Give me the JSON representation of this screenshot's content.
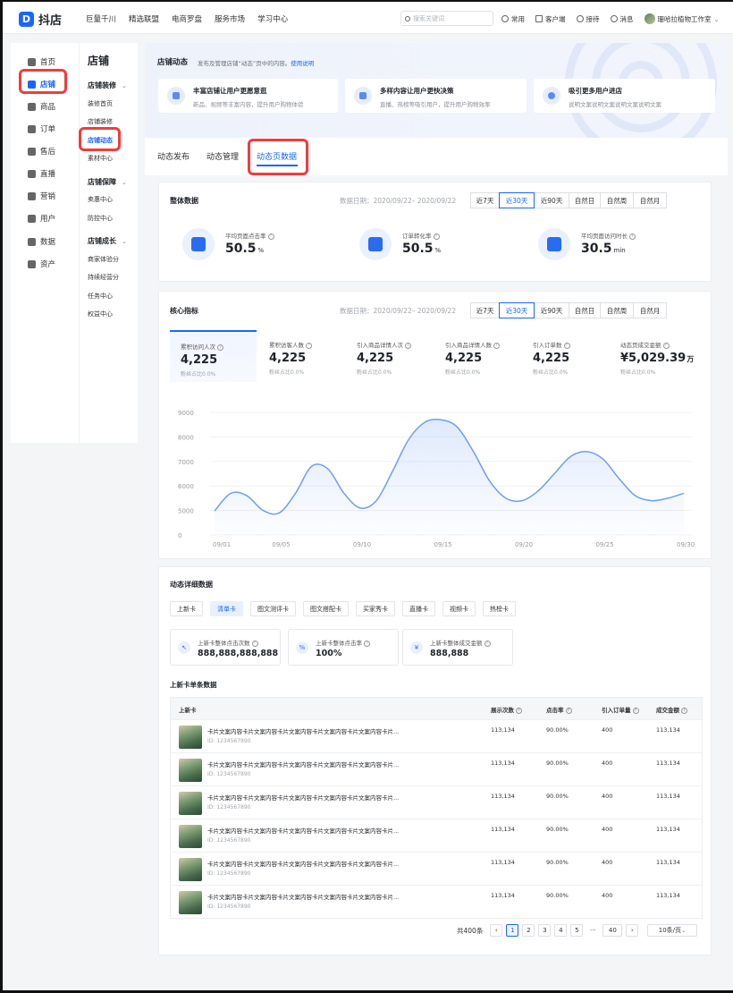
{
  "app": {
    "logo_text": "抖店"
  },
  "topnav": {
    "links": [
      "巨量千川",
      "精选联盟",
      "电商罗盘",
      "服务市场",
      "学习中心"
    ],
    "search_placeholder": "搜索关键词",
    "right": [
      "常用",
      "客户端",
      "接待",
      "消息"
    ],
    "shop_name": "珊哈拉植物工作室"
  },
  "sidebar": {
    "items": [
      {
        "label": "首页",
        "icon": "home-icon"
      },
      {
        "label": "店铺",
        "icon": "store-icon"
      },
      {
        "label": "商品",
        "icon": "product-icon"
      },
      {
        "label": "订单",
        "icon": "order-icon"
      },
      {
        "label": "售后",
        "icon": "aftersale-icon"
      },
      {
        "label": "直播",
        "icon": "live-icon"
      },
      {
        "label": "营销",
        "icon": "marketing-icon"
      },
      {
        "label": "用户",
        "icon": "user-icon"
      },
      {
        "label": "数据",
        "icon": "data-icon"
      },
      {
        "label": "资产",
        "icon": "asset-icon"
      }
    ],
    "active_index": 1
  },
  "subnav": {
    "title": "店铺",
    "groups": [
      {
        "label": "店铺装修",
        "items": [
          "装修首页",
          "店铺装修",
          "店铺动态",
          "素材中心"
        ]
      },
      {
        "label": "店铺保障",
        "items": [
          "卖惠中心",
          "防控中心"
        ]
      },
      {
        "label": "店铺成长",
        "items": [
          "商家体验分",
          "持续经营分",
          "任务中心",
          "权益中心"
        ]
      }
    ],
    "active_item": "店铺动态"
  },
  "banner": {
    "title": "店铺动态",
    "subtitle": "发布及管理店铺“动态”页中的内容。",
    "link": "使用说明",
    "features": [
      {
        "title": "丰富店铺让用户更愿意逛",
        "desc": "新品、视频等丰富内容，提升用户购物体验",
        "icon": "smile-icon"
      },
      {
        "title": "多样内容让用户更快决策",
        "desc": "直播、热榜等吸引用户，提升用户购物效率",
        "icon": "trend-icon"
      },
      {
        "title": "吸引更多用户进店",
        "desc": "说明文案说明文案说明文案说明文案",
        "icon": "person-icon"
      }
    ]
  },
  "tabs": {
    "items": [
      "动态发布",
      "动态管理",
      "动态页数据"
    ],
    "active": "动态页数据"
  },
  "overall": {
    "title": "整体数据",
    "date": "数据日期：2020/09/22– 2020/09/22",
    "ranges": [
      "近7天",
      "近30天",
      "近90天",
      "自然日",
      "自然周",
      "自然月"
    ],
    "active_range": "近30天",
    "kpis": [
      {
        "label": "平均页面点击率",
        "value": "50.5",
        "unit": "%"
      },
      {
        "label": "订单转化率",
        "value": "50.5",
        "unit": "%"
      },
      {
        "label": "平均页面访问时长",
        "value": "30.5",
        "unit": "min"
      }
    ]
  },
  "core": {
    "title": "核心指标",
    "date": "数据日期：2020/09/22– 2020/09/22",
    "ranges": [
      "近7天",
      "近30天",
      "近90天",
      "自然日",
      "自然周",
      "自然月"
    ],
    "active_range": "近30天",
    "metrics": [
      {
        "label": "累积访问人次",
        "value": "4,225",
        "sub": "粉丝占比0.0%"
      },
      {
        "label": "累积访客人数",
        "value": "4,225",
        "sub": "粉丝占比0.0%"
      },
      {
        "label": "引入商品详情人次",
        "value": "4,225",
        "sub": "粉丝占比0.0%"
      },
      {
        "label": "引入商品详情人数",
        "value": "4,225",
        "sub": "粉丝占比0.0%"
      },
      {
        "label": "引入订单数",
        "value": "4,225",
        "sub": "粉丝占比0.0%"
      },
      {
        "label": "动态页成交金额",
        "value": "¥5,029.39",
        "unit": "万",
        "sub": "粉丝占比0.0%"
      }
    ]
  },
  "chart_data": {
    "type": "area",
    "x_ticks": [
      "09/01",
      "09/05",
      "09/10",
      "09/15",
      "09/20",
      "09/25",
      "09/30"
    ],
    "y_ticks": [
      0,
      5000,
      6000,
      7000,
      8000,
      9000
    ],
    "points": [
      [
        1,
        4900
      ],
      [
        2,
        5700
      ],
      [
        3,
        5600
      ],
      [
        4,
        5000
      ],
      [
        5,
        4500
      ],
      [
        6,
        5700
      ],
      [
        7,
        6800
      ],
      [
        8,
        6700
      ],
      [
        9,
        5700
      ],
      [
        10,
        5100
      ],
      [
        11,
        5400
      ],
      [
        12,
        6600
      ],
      [
        13,
        7900
      ],
      [
        14,
        8600
      ],
      [
        15,
        8700
      ],
      [
        16,
        8400
      ],
      [
        17,
        7400
      ],
      [
        18,
        6200
      ],
      [
        19,
        5500
      ],
      [
        20,
        5400
      ],
      [
        21,
        5800
      ],
      [
        22,
        6500
      ],
      [
        23,
        7200
      ],
      [
        24,
        7400
      ],
      [
        25,
        7100
      ],
      [
        26,
        6300
      ],
      [
        27,
        5600
      ],
      [
        28,
        5400
      ],
      [
        29,
        5500
      ],
      [
        30,
        5700
      ]
    ]
  },
  "detail": {
    "title": "动态详细数据",
    "chips": [
      "上新卡",
      "清单卡",
      "图文测评卡",
      "图文搭配卡",
      "买家秀卡",
      "直播卡",
      "视频卡",
      "热榜卡"
    ],
    "active_chip": "清单卡",
    "summaries": [
      {
        "icon": "click-icon",
        "label": "上新卡整体点击次数",
        "value": "888,888,888,888"
      },
      {
        "icon": "percent-icon",
        "label": "上新卡整体点击率",
        "value": "100%"
      },
      {
        "icon": "yen-icon",
        "label": "上新卡整体成交金额",
        "value": "888,888"
      }
    ],
    "table_title": "上新卡单条数据",
    "columns": [
      "上新卡",
      "展示次数",
      "点击率",
      "引入订单量",
      "成交金额"
    ],
    "rows": [
      {
        "title": "卡片文案内容卡片文案内容卡片文案内容卡片文案内容卡片文案内容卡片...",
        "id": "ID: 1234567890",
        "views": "113,134",
        "ctr": "90.00%",
        "orders": "400",
        "amount": "113,134"
      },
      {
        "title": "卡片文案内容卡片文案内容卡片文案内容卡片文案内容卡片文案内容卡片...",
        "id": "ID: 1234567890",
        "views": "113,134",
        "ctr": "90.00%",
        "orders": "400",
        "amount": "113,134"
      },
      {
        "title": "卡片文案内容卡片文案内容卡片文案内容卡片文案内容卡片文案内容卡片...",
        "id": "ID: 1234567890",
        "views": "113,134",
        "ctr": "90.00%",
        "orders": "400",
        "amount": "113,134"
      },
      {
        "title": "卡片文案内容卡片文案内容卡片文案内容卡片文案内容卡片文案内容卡片...",
        "id": "ID: 1234567890",
        "views": "113,134",
        "ctr": "90.00%",
        "orders": "400",
        "amount": "113,134"
      },
      {
        "title": "卡片文案内容卡片文案内容卡片文案内容卡片文案内容卡片文案内容卡片...",
        "id": "ID: 1234567890",
        "views": "113,134",
        "ctr": "90.00%",
        "orders": "400",
        "amount": "113,134"
      },
      {
        "title": "卡片文案内容卡片文案内容卡片文案内容卡片文案内容卡片文案内容卡片...",
        "id": "ID: 1234567890",
        "views": "113,134",
        "ctr": "90.00%",
        "orders": "400",
        "amount": "113,134"
      }
    ],
    "pagination": {
      "total": "共400条",
      "pages": [
        "1",
        "2",
        "3",
        "4",
        "5",
        "···",
        "40"
      ],
      "current": "1",
      "page_size": "10条/页"
    }
  },
  "colors": {
    "accent": "#1966ff",
    "highlight": "#f23c3c"
  }
}
